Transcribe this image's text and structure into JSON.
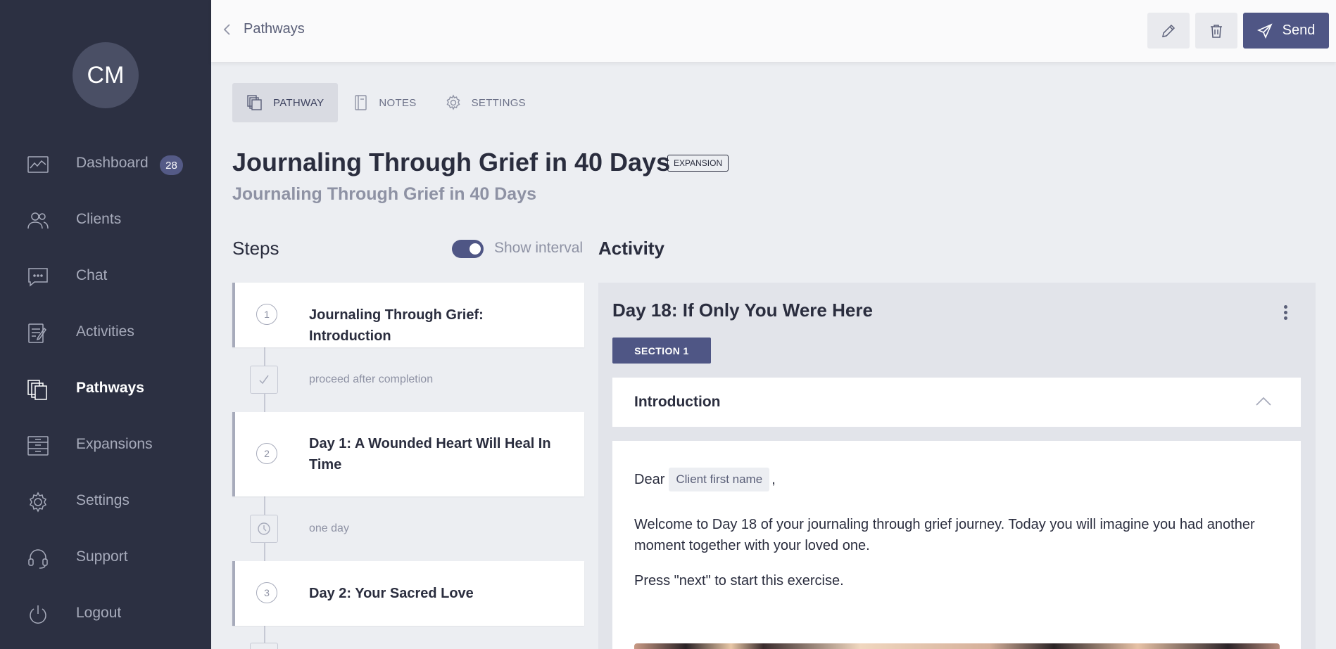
{
  "sidebar": {
    "avatar_initials": "CM",
    "items": [
      {
        "label": "Dashboard",
        "icon": "chart-icon",
        "badge": "28"
      },
      {
        "label": "Clients",
        "icon": "users-icon"
      },
      {
        "label": "Chat",
        "icon": "chat-icon"
      },
      {
        "label": "Activities",
        "icon": "activities-icon"
      },
      {
        "label": "Pathways",
        "icon": "pathways-icon",
        "active": true
      },
      {
        "label": "Expansions",
        "icon": "expansions-icon"
      },
      {
        "label": "Settings",
        "icon": "gear-icon"
      },
      {
        "label": "Support",
        "icon": "headset-icon"
      },
      {
        "label": "Logout",
        "icon": "power-icon"
      }
    ]
  },
  "header": {
    "back_label": "Pathways",
    "send_label": "Send"
  },
  "tabs": [
    {
      "label": "PATHWAY",
      "active": true
    },
    {
      "label": "NOTES"
    },
    {
      "label": "SETTINGS"
    }
  ],
  "pathway": {
    "title": "Journaling Through Grief in 40 Days",
    "badge": "EXPANSION",
    "subtitle": "Journaling Through Grief in 40 Days"
  },
  "steps_section": {
    "heading": "Steps",
    "toggle_label": "Show interval",
    "toggle_on": true,
    "steps": [
      {
        "number": "1",
        "title": "Journaling Through Grief: Introduction"
      },
      {
        "number": "2",
        "title": "Day 1: A Wounded Heart Will Heal In Time"
      },
      {
        "number": "3",
        "title": "Day 2: Your Sacred Love"
      }
    ],
    "intervals": [
      {
        "label": "proceed after completion",
        "icon": "check-icon"
      },
      {
        "label": "one day",
        "icon": "clock-icon"
      }
    ]
  },
  "activity": {
    "heading": "Activity",
    "title": "Day 18: If Only You Were Here",
    "section_label": "SECTION 1",
    "accordion_label": "Introduction",
    "dear": "Dear",
    "placeholder_chip": "Client first name",
    "comma": ",",
    "paragraph1": "Welcome to Day 18 of your journaling through grief journey. Today you will imagine you had another moment together with your loved one.",
    "paragraph2": "Press \"next\" to start this exercise."
  },
  "colors": {
    "sidebar_bg": "#2c3042",
    "accent": "#4f5685",
    "page_bg": "#eceef2"
  }
}
